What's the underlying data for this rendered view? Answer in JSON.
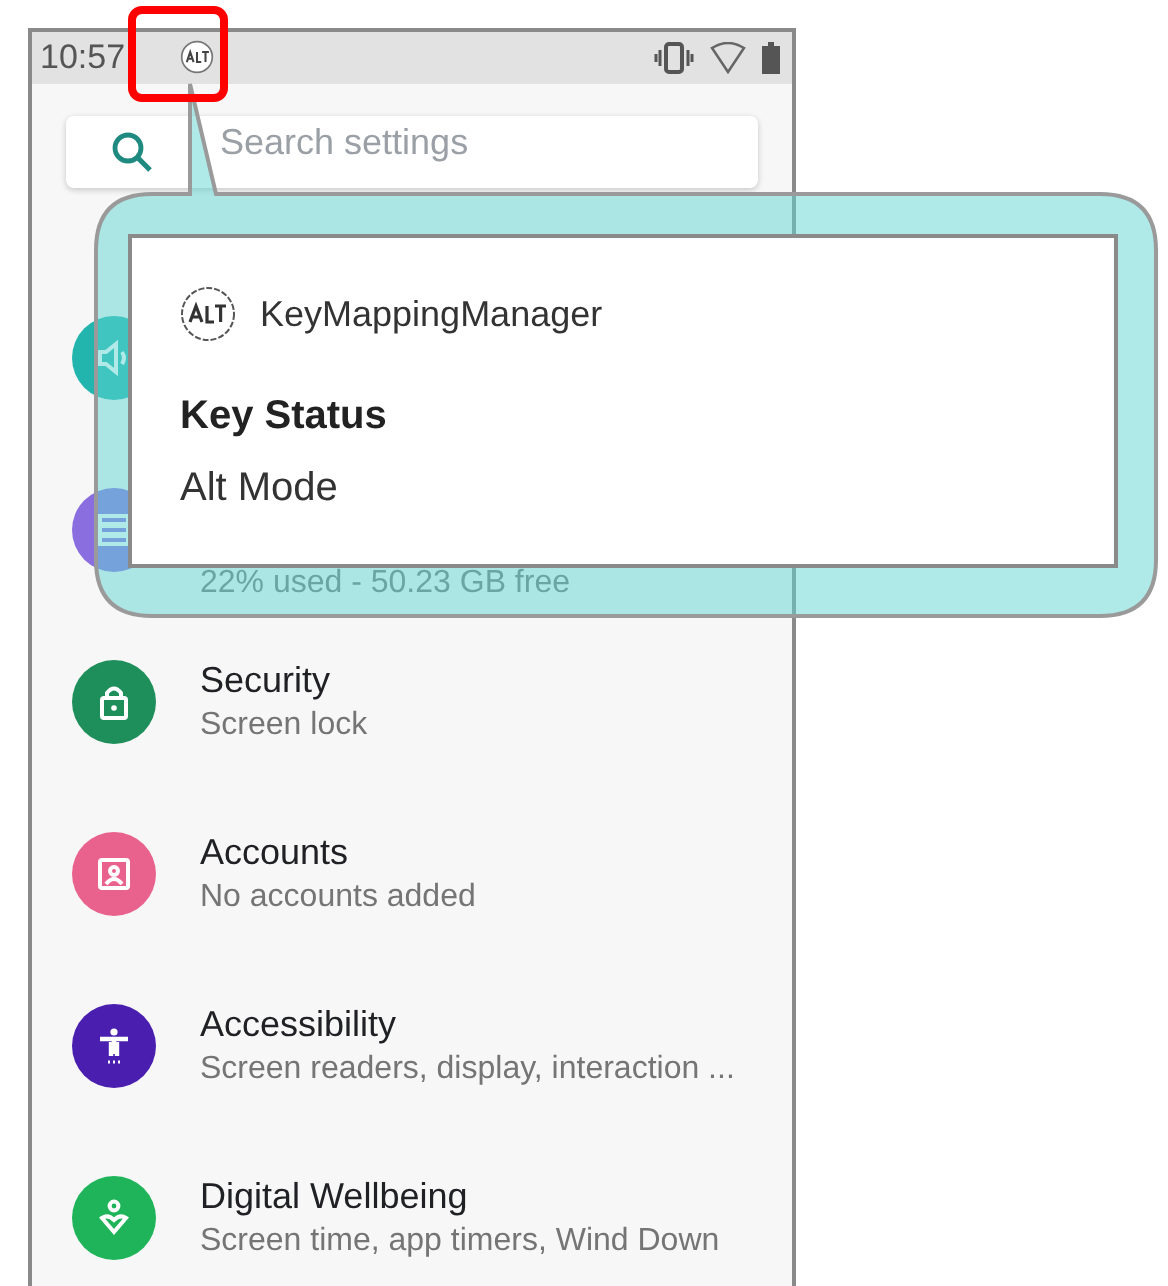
{
  "status_bar": {
    "time": "10:57"
  },
  "search": {
    "placeholder": "Search settings"
  },
  "settings": [
    {
      "kind": "sound",
      "color": "#22b5ad"
    },
    {
      "kind": "storage",
      "color": "#8a6ee0",
      "subtitle": "22% used - 50.23 GB free"
    },
    {
      "kind": "security",
      "color": "#1e8e5a",
      "title": "Security",
      "subtitle": "Screen lock"
    },
    {
      "kind": "accounts",
      "color": "#e9628e",
      "title": "Accounts",
      "subtitle": "No accounts added"
    },
    {
      "kind": "accessibility",
      "color": "#4a1fb0",
      "title": "Accessibility",
      "subtitle": "Screen readers, display, interaction ..."
    },
    {
      "kind": "wellbeing",
      "color": "#1fb45a",
      "title": "Digital Wellbeing",
      "subtitle": "Screen time, app timers, Wind Down"
    }
  ],
  "notification": {
    "app_name": "KeyMappingManager",
    "title": "Key Status",
    "text": "Alt Mode"
  }
}
